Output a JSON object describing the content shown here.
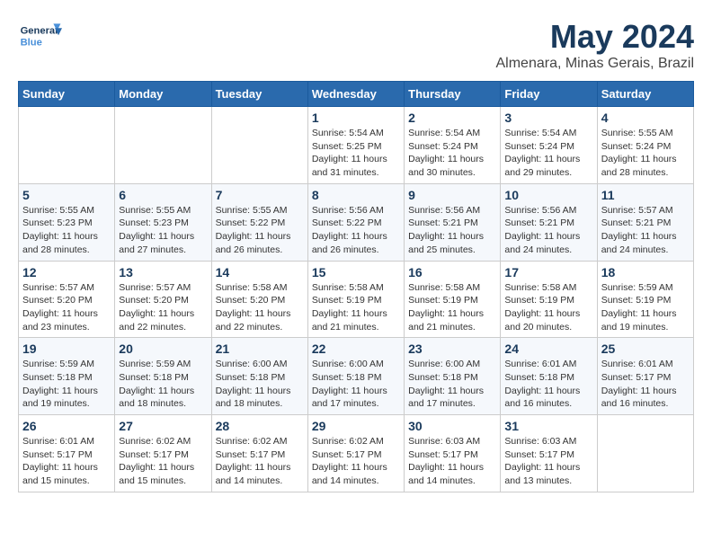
{
  "header": {
    "logo_line1": "General",
    "logo_line2": "Blue",
    "month": "May 2024",
    "location": "Almenara, Minas Gerais, Brazil"
  },
  "weekdays": [
    "Sunday",
    "Monday",
    "Tuesday",
    "Wednesday",
    "Thursday",
    "Friday",
    "Saturday"
  ],
  "weeks": [
    [
      {
        "day": "",
        "sunrise": "",
        "sunset": "",
        "daylight": ""
      },
      {
        "day": "",
        "sunrise": "",
        "sunset": "",
        "daylight": ""
      },
      {
        "day": "",
        "sunrise": "",
        "sunset": "",
        "daylight": ""
      },
      {
        "day": "1",
        "sunrise": "Sunrise: 5:54 AM",
        "sunset": "Sunset: 5:25 PM",
        "daylight": "Daylight: 11 hours and 31 minutes."
      },
      {
        "day": "2",
        "sunrise": "Sunrise: 5:54 AM",
        "sunset": "Sunset: 5:24 PM",
        "daylight": "Daylight: 11 hours and 30 minutes."
      },
      {
        "day": "3",
        "sunrise": "Sunrise: 5:54 AM",
        "sunset": "Sunset: 5:24 PM",
        "daylight": "Daylight: 11 hours and 29 minutes."
      },
      {
        "day": "4",
        "sunrise": "Sunrise: 5:55 AM",
        "sunset": "Sunset: 5:24 PM",
        "daylight": "Daylight: 11 hours and 28 minutes."
      }
    ],
    [
      {
        "day": "5",
        "sunrise": "Sunrise: 5:55 AM",
        "sunset": "Sunset: 5:23 PM",
        "daylight": "Daylight: 11 hours and 28 minutes."
      },
      {
        "day": "6",
        "sunrise": "Sunrise: 5:55 AM",
        "sunset": "Sunset: 5:23 PM",
        "daylight": "Daylight: 11 hours and 27 minutes."
      },
      {
        "day": "7",
        "sunrise": "Sunrise: 5:55 AM",
        "sunset": "Sunset: 5:22 PM",
        "daylight": "Daylight: 11 hours and 26 minutes."
      },
      {
        "day": "8",
        "sunrise": "Sunrise: 5:56 AM",
        "sunset": "Sunset: 5:22 PM",
        "daylight": "Daylight: 11 hours and 26 minutes."
      },
      {
        "day": "9",
        "sunrise": "Sunrise: 5:56 AM",
        "sunset": "Sunset: 5:21 PM",
        "daylight": "Daylight: 11 hours and 25 minutes."
      },
      {
        "day": "10",
        "sunrise": "Sunrise: 5:56 AM",
        "sunset": "Sunset: 5:21 PM",
        "daylight": "Daylight: 11 hours and 24 minutes."
      },
      {
        "day": "11",
        "sunrise": "Sunrise: 5:57 AM",
        "sunset": "Sunset: 5:21 PM",
        "daylight": "Daylight: 11 hours and 24 minutes."
      }
    ],
    [
      {
        "day": "12",
        "sunrise": "Sunrise: 5:57 AM",
        "sunset": "Sunset: 5:20 PM",
        "daylight": "Daylight: 11 hours and 23 minutes."
      },
      {
        "day": "13",
        "sunrise": "Sunrise: 5:57 AM",
        "sunset": "Sunset: 5:20 PM",
        "daylight": "Daylight: 11 hours and 22 minutes."
      },
      {
        "day": "14",
        "sunrise": "Sunrise: 5:58 AM",
        "sunset": "Sunset: 5:20 PM",
        "daylight": "Daylight: 11 hours and 22 minutes."
      },
      {
        "day": "15",
        "sunrise": "Sunrise: 5:58 AM",
        "sunset": "Sunset: 5:19 PM",
        "daylight": "Daylight: 11 hours and 21 minutes."
      },
      {
        "day": "16",
        "sunrise": "Sunrise: 5:58 AM",
        "sunset": "Sunset: 5:19 PM",
        "daylight": "Daylight: 11 hours and 21 minutes."
      },
      {
        "day": "17",
        "sunrise": "Sunrise: 5:58 AM",
        "sunset": "Sunset: 5:19 PM",
        "daylight": "Daylight: 11 hours and 20 minutes."
      },
      {
        "day": "18",
        "sunrise": "Sunrise: 5:59 AM",
        "sunset": "Sunset: 5:19 PM",
        "daylight": "Daylight: 11 hours and 19 minutes."
      }
    ],
    [
      {
        "day": "19",
        "sunrise": "Sunrise: 5:59 AM",
        "sunset": "Sunset: 5:18 PM",
        "daylight": "Daylight: 11 hours and 19 minutes."
      },
      {
        "day": "20",
        "sunrise": "Sunrise: 5:59 AM",
        "sunset": "Sunset: 5:18 PM",
        "daylight": "Daylight: 11 hours and 18 minutes."
      },
      {
        "day": "21",
        "sunrise": "Sunrise: 6:00 AM",
        "sunset": "Sunset: 5:18 PM",
        "daylight": "Daylight: 11 hours and 18 minutes."
      },
      {
        "day": "22",
        "sunrise": "Sunrise: 6:00 AM",
        "sunset": "Sunset: 5:18 PM",
        "daylight": "Daylight: 11 hours and 17 minutes."
      },
      {
        "day": "23",
        "sunrise": "Sunrise: 6:00 AM",
        "sunset": "Sunset: 5:18 PM",
        "daylight": "Daylight: 11 hours and 17 minutes."
      },
      {
        "day": "24",
        "sunrise": "Sunrise: 6:01 AM",
        "sunset": "Sunset: 5:18 PM",
        "daylight": "Daylight: 11 hours and 16 minutes."
      },
      {
        "day": "25",
        "sunrise": "Sunrise: 6:01 AM",
        "sunset": "Sunset: 5:17 PM",
        "daylight": "Daylight: 11 hours and 16 minutes."
      }
    ],
    [
      {
        "day": "26",
        "sunrise": "Sunrise: 6:01 AM",
        "sunset": "Sunset: 5:17 PM",
        "daylight": "Daylight: 11 hours and 15 minutes."
      },
      {
        "day": "27",
        "sunrise": "Sunrise: 6:02 AM",
        "sunset": "Sunset: 5:17 PM",
        "daylight": "Daylight: 11 hours and 15 minutes."
      },
      {
        "day": "28",
        "sunrise": "Sunrise: 6:02 AM",
        "sunset": "Sunset: 5:17 PM",
        "daylight": "Daylight: 11 hours and 14 minutes."
      },
      {
        "day": "29",
        "sunrise": "Sunrise: 6:02 AM",
        "sunset": "Sunset: 5:17 PM",
        "daylight": "Daylight: 11 hours and 14 minutes."
      },
      {
        "day": "30",
        "sunrise": "Sunrise: 6:03 AM",
        "sunset": "Sunset: 5:17 PM",
        "daylight": "Daylight: 11 hours and 14 minutes."
      },
      {
        "day": "31",
        "sunrise": "Sunrise: 6:03 AM",
        "sunset": "Sunset: 5:17 PM",
        "daylight": "Daylight: 11 hours and 13 minutes."
      },
      {
        "day": "",
        "sunrise": "",
        "sunset": "",
        "daylight": ""
      }
    ]
  ]
}
